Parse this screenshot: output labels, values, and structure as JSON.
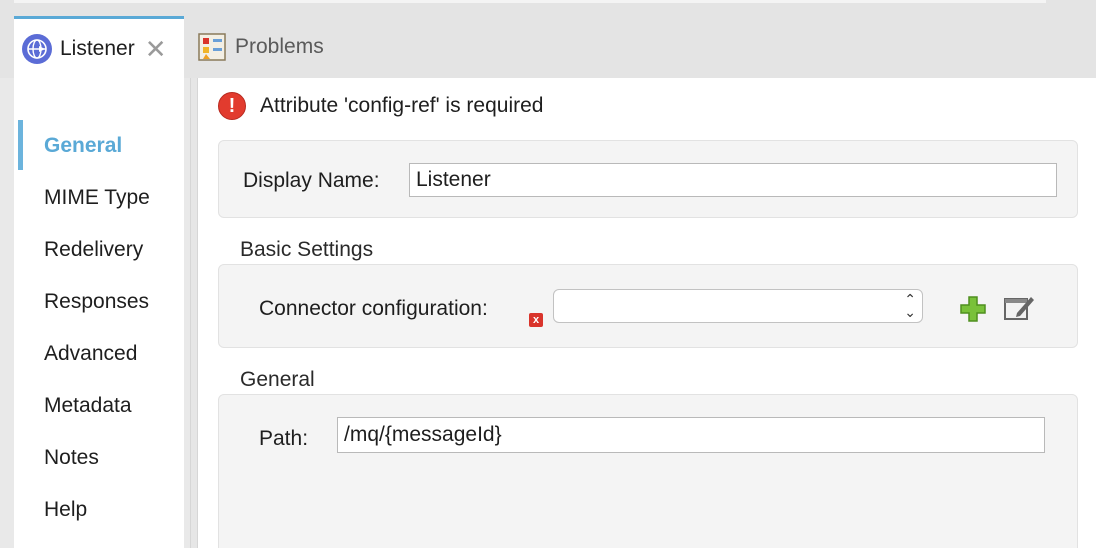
{
  "tabs": [
    {
      "label": "Listener",
      "active": true
    },
    {
      "label": "Problems",
      "active": false
    }
  ],
  "nav": {
    "items": [
      "General",
      "MIME Type",
      "Redelivery",
      "Responses",
      "Advanced",
      "Metadata",
      "Notes",
      "Help"
    ],
    "active": "General"
  },
  "error": {
    "message": "Attribute 'config-ref' is required"
  },
  "display": {
    "label": "Display Name:",
    "value": "Listener"
  },
  "basic": {
    "title": "Basic Settings",
    "connector_label": "Connector configuration:",
    "connector_value": ""
  },
  "general": {
    "title": "General",
    "path_label": "Path:",
    "path_value": "/mq/{messageId}"
  },
  "colors": {
    "accent": "#5aa9d6",
    "error": "#e23b2e",
    "add": "#6fbf2f"
  }
}
